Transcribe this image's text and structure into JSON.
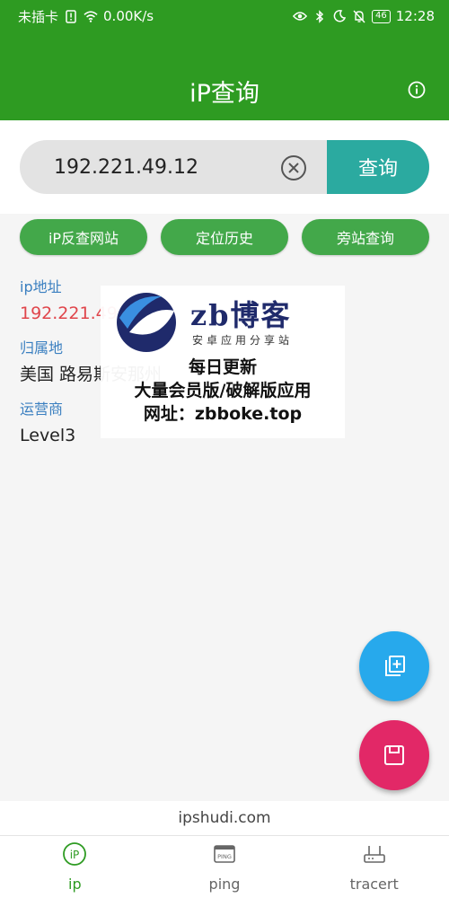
{
  "status_bar": {
    "carrier": "未插卡",
    "speed": "0.00K/s",
    "battery": "46",
    "time": "12:28",
    "icons": [
      "sim-alert-icon",
      "wifi-icon",
      "eye-icon",
      "bluetooth-icon",
      "moon-icon",
      "bell-off-icon",
      "battery-icon"
    ]
  },
  "app_bar": {
    "title": "iP查询",
    "info_icon": "info-icon"
  },
  "search": {
    "value": "192.221.49.12",
    "clear_icon": "clear-circle-icon",
    "submit_label": "查询"
  },
  "actions": [
    {
      "label": "iP反查网站"
    },
    {
      "label": "定位历史"
    },
    {
      "label": "旁站查询"
    }
  ],
  "result": {
    "ip_label": "ip地址",
    "ip_value": "192.221.49.12",
    "location_label": "归属地",
    "location_value": "美国 路易斯安那州",
    "isp_label": "运营商",
    "isp_value": "Level3"
  },
  "watermark": {
    "brand": "zb博客",
    "subtitle": "安卓应用分享站",
    "line1": "每日更新",
    "line2": "大量会员版/破解版应用",
    "line3": "网址：zbboke.top"
  },
  "fabs": {
    "add_icon": "add-copy-icon",
    "save_icon": "save-icon"
  },
  "footer": {
    "site": "ipshudi.com"
  },
  "bottom_nav": [
    {
      "label": "ip",
      "icon": "ip-icon",
      "active": true
    },
    {
      "label": "ping",
      "icon": "ping-icon",
      "active": false
    },
    {
      "label": "tracert",
      "icon": "router-icon",
      "active": false
    }
  ],
  "colors": {
    "primary": "#2e9b22",
    "accent_teal": "#2baaa0",
    "chip": "#43a84a",
    "label_blue": "#3a7fc0",
    "ip_red": "#e0454b",
    "fab_blue": "#27a9ec",
    "fab_pink": "#e22867"
  }
}
